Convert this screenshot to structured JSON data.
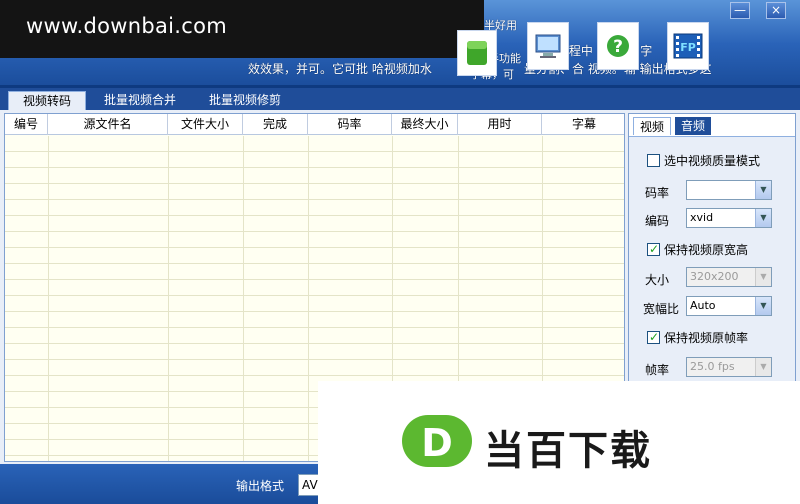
{
  "window": {
    "watermark_site": "www.downbai.com",
    "minimize": "—",
    "close": "×"
  },
  "toolbar": {
    "buttons": [
      {
        "icon": "green-flag-icon"
      },
      {
        "icon": "monitor-icon"
      },
      {
        "icon": "help-question-icon"
      },
      {
        "icon": "film-fp-icon"
      }
    ],
    "scroll_text_1": "效效果，并可。它可批 哈视频加水",
    "scroll_text_2": "可   作过程中   随意  置  字",
    "scroll_text_3": "量分割、合  视频。输   输出格式多这",
    "scroll_text_4": "字幕，可",
    "scroll_text_5": "半功能",
    "scroll_text_6": "半好用"
  },
  "tabs": [
    {
      "label": "视频转码",
      "active": true
    },
    {
      "label": "批量视频合并",
      "active": false
    },
    {
      "label": "批量视频修剪",
      "active": false
    }
  ],
  "table": {
    "columns": [
      "编号",
      "源文件名",
      "文件大小",
      "完成",
      "码率",
      "最终大小",
      "用时",
      "字幕"
    ],
    "rows": []
  },
  "panel": {
    "tabs": {
      "video": "视频",
      "audio": "音频"
    },
    "quality_mode": {
      "label": "选中视频质量模式",
      "checked": false
    },
    "bitrate": {
      "label": "码率",
      "value": ""
    },
    "codec": {
      "label": "编码",
      "value": "xvid"
    },
    "keep_size": {
      "label": "保持视频原宽高",
      "checked": true
    },
    "size": {
      "label": "大小",
      "value": "320x200",
      "disabled": true
    },
    "aspect": {
      "label": "宽幅比",
      "value": "Auto"
    },
    "keep_fps": {
      "label": "保持视频原帧率",
      "checked": true
    },
    "fps": {
      "label": "帧率",
      "value": "25.0 fps",
      "disabled": true
    }
  },
  "bottom": {
    "output_format_label": "输出格式",
    "output_format_value": "AV"
  },
  "watermark": {
    "brand": "当百下载",
    "logo_letter": "D"
  },
  "colors": {
    "header_blue": "#2a63b8",
    "tab_dark": "#1f4d99",
    "grid_bg": "#fffff2",
    "check_green": "#21a121",
    "logo_green": "#5cb830"
  }
}
